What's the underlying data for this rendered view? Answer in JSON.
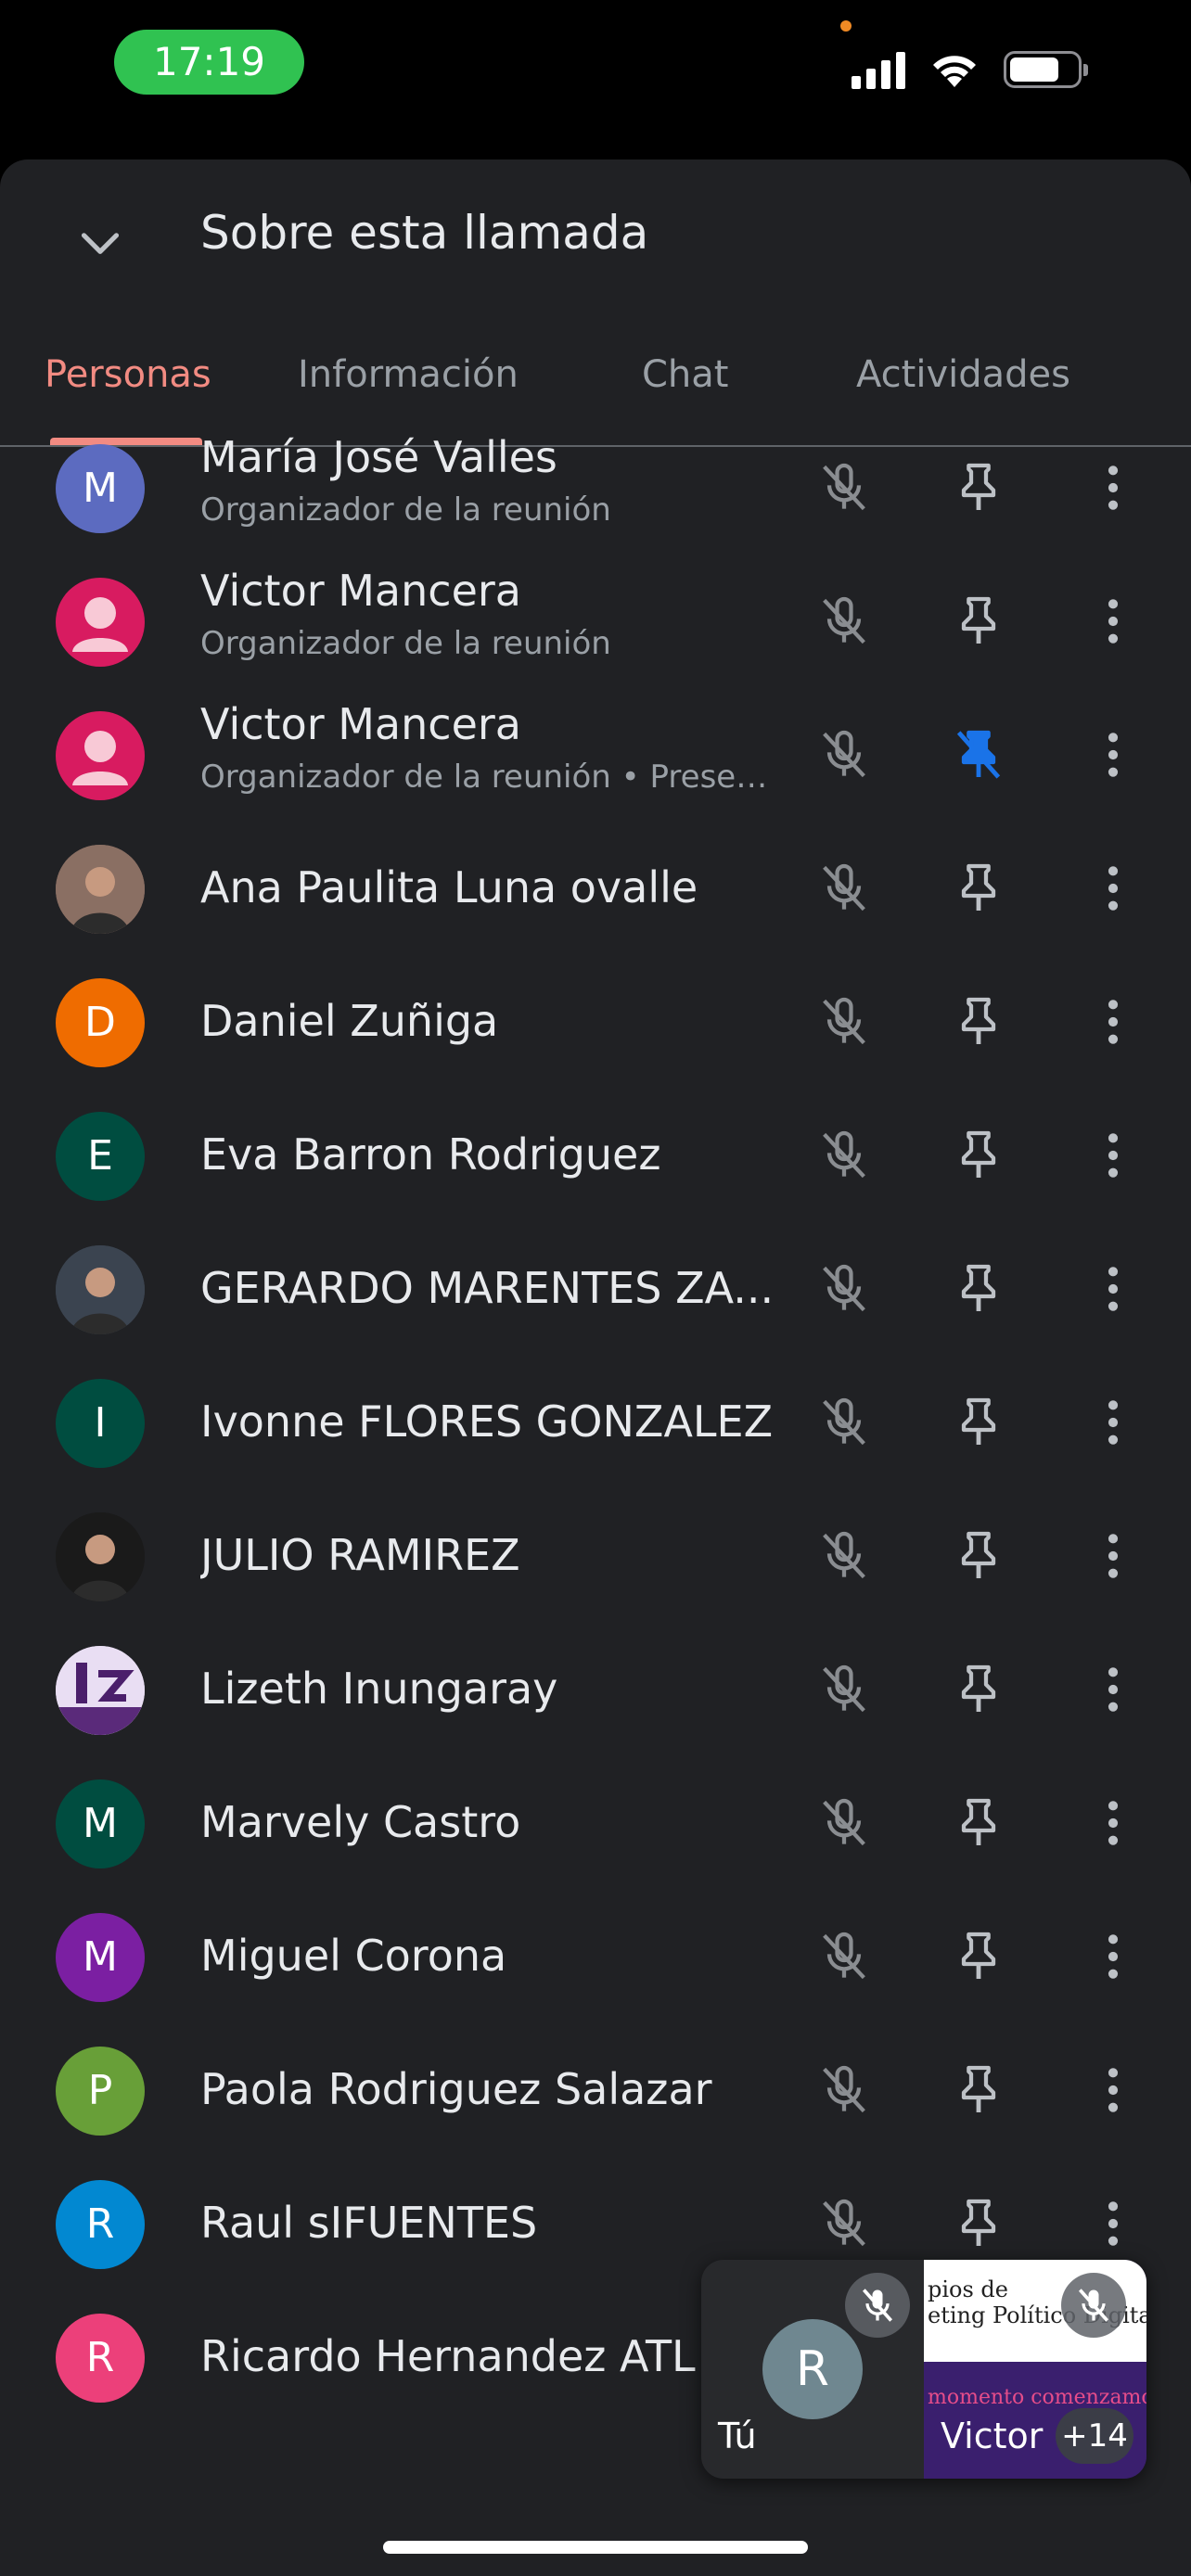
{
  "status_bar": {
    "time": "17:19"
  },
  "header": {
    "title": "Sobre esta llamada"
  },
  "tabs": [
    {
      "label": "Personas",
      "active": true
    },
    {
      "label": "Información",
      "active": false
    },
    {
      "label": "Chat",
      "active": false
    },
    {
      "label": "Actividades",
      "active": false
    }
  ],
  "participants": [
    {
      "name": "María José Valles",
      "subtitle": "Organizador de la reunión",
      "avatar_letter": "M",
      "avatar_color": "#5c6bc0",
      "avatar_type": "letter",
      "muted": true,
      "pinned": false
    },
    {
      "name": "Victor Mancera",
      "subtitle": "Organizador de la reunión",
      "avatar_letter": "",
      "avatar_color": "#d81b60",
      "avatar_type": "person",
      "muted": true,
      "pinned": false
    },
    {
      "name": "Victor Mancera",
      "subtitle": "Organizador de la reunión • Presen...",
      "avatar_letter": "",
      "avatar_color": "#d81b60",
      "avatar_type": "person",
      "muted": true,
      "pinned": true
    },
    {
      "name": "Ana Paulita Luna ovalle",
      "subtitle": "",
      "avatar_letter": "",
      "avatar_color": "#8a6f63",
      "avatar_type": "photo",
      "muted": true,
      "pinned": false
    },
    {
      "name": "Daniel Zuñiga",
      "subtitle": "",
      "avatar_letter": "D",
      "avatar_color": "#ef6c00",
      "avatar_type": "letter",
      "muted": true,
      "pinned": false
    },
    {
      "name": "Eva Barron Rodriguez",
      "subtitle": "",
      "avatar_letter": "E",
      "avatar_color": "#004d40",
      "avatar_type": "letter",
      "muted": true,
      "pinned": false
    },
    {
      "name": "GERARDO MARENTES ZA...",
      "subtitle": "",
      "avatar_letter": "",
      "avatar_color": "#3b4450",
      "avatar_type": "photo",
      "muted": true,
      "pinned": false
    },
    {
      "name": "Ivonne FLORES GONZALEZ",
      "subtitle": "",
      "avatar_letter": "I",
      "avatar_color": "#004d40",
      "avatar_type": "letter",
      "muted": true,
      "pinned": false
    },
    {
      "name": "JULIO RAMIREZ",
      "subtitle": "",
      "avatar_letter": "",
      "avatar_color": "#1a1a1a",
      "avatar_type": "photo",
      "muted": true,
      "pinned": false
    },
    {
      "name": "Lizeth Inungaray",
      "subtitle": "",
      "avatar_letter": "",
      "avatar_color": "#d9cbe8",
      "avatar_type": "logo",
      "muted": true,
      "pinned": false
    },
    {
      "name": "Marvely Castro",
      "subtitle": "",
      "avatar_letter": "M",
      "avatar_color": "#004d40",
      "avatar_type": "letter",
      "muted": true,
      "pinned": false
    },
    {
      "name": "Miguel Corona",
      "subtitle": "",
      "avatar_letter": "M",
      "avatar_color": "#7b1fa2",
      "avatar_type": "letter",
      "muted": true,
      "pinned": false
    },
    {
      "name": "Paola Rodriguez Salazar",
      "subtitle": "",
      "avatar_letter": "P",
      "avatar_color": "#689f38",
      "avatar_type": "letter",
      "muted": true,
      "pinned": false
    },
    {
      "name": "Raul sIFUENTES",
      "subtitle": "",
      "avatar_letter": "R",
      "avatar_color": "#0288d1",
      "avatar_type": "letter",
      "muted": true,
      "pinned": false
    },
    {
      "name": "Ricardo Hernandez ATL",
      "subtitle": "",
      "avatar_letter": "R",
      "avatar_color": "#ec407a",
      "avatar_type": "letter",
      "muted": true,
      "pinned": false
    }
  ],
  "mini_preview": {
    "self_label": "Tú",
    "self_avatar_letter": "R",
    "other_label": "Victor",
    "others_count": "+14",
    "slide_line1": "pios de",
    "slide_line2": "eting Político Digital",
    "slide_line3": "momento comenzamos"
  },
  "colors": {
    "accent": "#f28b82",
    "pinned_blue": "#1a73e8",
    "background": "#202124"
  }
}
